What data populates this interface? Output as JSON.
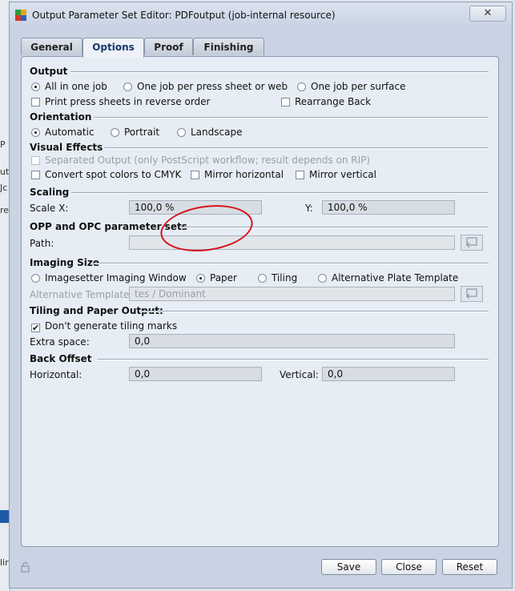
{
  "window": {
    "title": "Output Parameter Set Editor: PDFoutput (job-internal resource)",
    "close": "✕"
  },
  "background": {
    "frag_p": "P",
    "frag_ut": "ut",
    "frag_jc": "Jc",
    "frag_re": "re",
    "frag_lir": "lir"
  },
  "tabs": [
    "General",
    "Options",
    "Proof",
    "Finishing"
  ],
  "active_tab": "Options",
  "output": {
    "heading": "Output",
    "all_in_one": "All in one job",
    "per_press_sheet": "One job per press sheet or web",
    "per_surface": "One job per surface",
    "reverse_order": "Print press sheets in reverse order",
    "rearrange_back": "Rearrange Back"
  },
  "orientation": {
    "heading": "Orientation",
    "automatic": "Automatic",
    "portrait": "Portrait",
    "landscape": "Landscape"
  },
  "visual_effects": {
    "heading": "Visual Effects",
    "separated_output": "Separated Output (only PostScript workflow; result depends on RIP)",
    "convert_spot": "Convert spot colors to CMYK",
    "mirror_horizontal": "Mirror horizontal",
    "mirror_vertical": "Mirror vertical"
  },
  "scaling": {
    "heading": "Scaling",
    "scale_x_label": "Scale X:",
    "scale_x_value": "100,0 %",
    "y_label": "Y:",
    "y_value": "100,0 %"
  },
  "opp": {
    "heading": "OPP and OPC parameter sets",
    "path_label": "Path:",
    "path_value": ""
  },
  "imaging_size": {
    "heading": "Imaging Size",
    "imagesetter": "Imagesetter Imaging Window",
    "paper": "Paper",
    "tiling": "Tiling",
    "alt_plate": "Alternative Plate Template",
    "alt_template_label": "Alternative Template:",
    "alt_template_value": "tes / Dominant"
  },
  "tiling_output": {
    "heading": "Tiling and Paper Output:",
    "no_tiling_marks": "Don't generate tiling marks",
    "check_mark": "✔",
    "extra_space_label": "Extra space:",
    "extra_space_value": "0,0"
  },
  "back_offset": {
    "heading": "Back Offset",
    "horizontal_label": "Horizontal:",
    "horizontal_value": "0,0",
    "vertical_label": "Vertical:",
    "vertical_value": "0,0"
  },
  "footer": {
    "save": "Save",
    "close": "Close",
    "reset": "Reset"
  },
  "colors": {
    "annotation_circle": "#d4141c",
    "active_tab_text": "#17366b"
  },
  "icons": [
    "app-icon",
    "lock-icon",
    "file-picker-icon"
  ]
}
